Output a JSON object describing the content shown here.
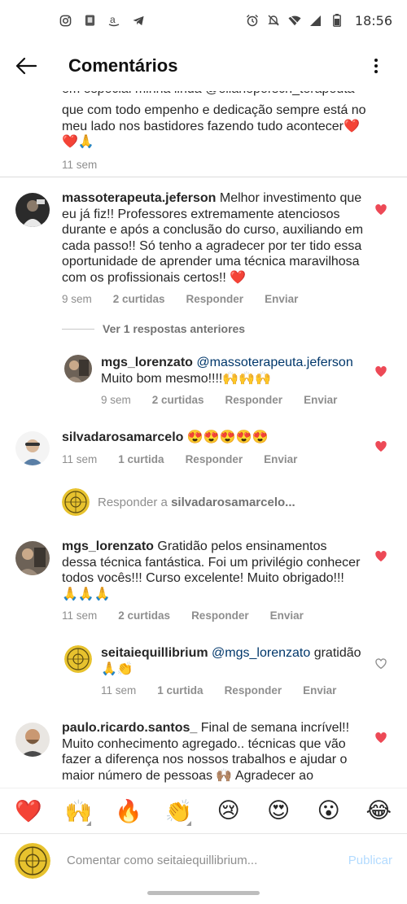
{
  "status_bar": {
    "time": "18:56",
    "left_icons": [
      "instagram-icon",
      "phone-app-icon",
      "amazon-icon",
      "telegram-icon"
    ],
    "right_icons": [
      "alarm-icon",
      "mute-icon",
      "wifi-icon",
      "signal-icon",
      "battery-icon"
    ]
  },
  "header": {
    "title": "Comentários"
  },
  "caption": {
    "clipped_line": "em especial minha linda @elianeporsch_terapeuta",
    "lines": "que com todo empenho e dedicação sempre está no meu lado nos bastidores fazendo tudo acontecer❤️",
    "emoji_line": "❤️🙏",
    "time": "11 sem"
  },
  "comments": [
    {
      "username": "massoterapeuta.jeferson",
      "text": "Melhor investimento que eu já fiz!! Professores extremamente atenciosos durante e após a conclusão do curso, auxiliando em cada passo!! Só tenho a agradecer por ter tido essa oportunidade de aprender uma técnica maravilhosa com os profissionais certos!! ❤️",
      "time": "9 sem",
      "likes": "2 curtidas",
      "reply": "Responder",
      "send": "Enviar",
      "view_replies": "Ver 1 respostas anteriores",
      "replies": [
        {
          "username": "mgs_lorenzato",
          "mention": "@massoterapeuta.jeferson",
          "text": "Muito bom mesmo!!!!🙌🙌🙌",
          "time": "9 sem",
          "likes": "2 curtidas",
          "reply": "Responder",
          "send": "Enviar"
        }
      ]
    },
    {
      "username": "silvadarosamarcelo",
      "text": "😍😍😍😍😍",
      "time": "11 sem",
      "likes": "1 curtida",
      "reply": "Responder",
      "send": "Enviar",
      "reply_prompt_prefix": "Responder a ",
      "reply_prompt_user": "silvadarosamarcelo..."
    },
    {
      "username": "mgs_lorenzato",
      "text": "Gratidão pelos ensinamentos dessa técnica fantástica. Foi um privilégio conhecer todos vocês!!! Curso excelente! Muito obrigado!!! 🙏🙏🙏",
      "time": "11 sem",
      "likes": "2 curtidas",
      "reply": "Responder",
      "send": "Enviar",
      "replies": [
        {
          "username": "seitaiequillibrium",
          "mention": "@mgs_lorenzato",
          "text": "gratidão 🙏👏",
          "time": "11 sem",
          "likes": "1 curtida",
          "reply": "Responder",
          "send": "Enviar"
        }
      ]
    },
    {
      "username": "paulo.ricardo.santos_",
      "text": "Final de semana incrível!! Muito conhecimento agregado.. técnicas que vão fazer a diferença nos nossos trabalhos e ajudar o maior número de pessoas 🙌🏽 Agradecer ao",
      "time": "",
      "likes": "",
      "reply": "",
      "send": ""
    }
  ],
  "emoji_bar": [
    "❤️",
    "🙌",
    "🔥",
    "👏",
    "😢",
    "😍",
    "😮",
    "😂"
  ],
  "composer": {
    "placeholder": "Comentar como seitaiequillibrium...",
    "post_label": "Publicar"
  },
  "colors": {
    "heart_red": "#ed4956",
    "mention_blue": "#00376b",
    "meta_gray": "#8e8e8e",
    "post_disabled": "#b3dbff"
  }
}
